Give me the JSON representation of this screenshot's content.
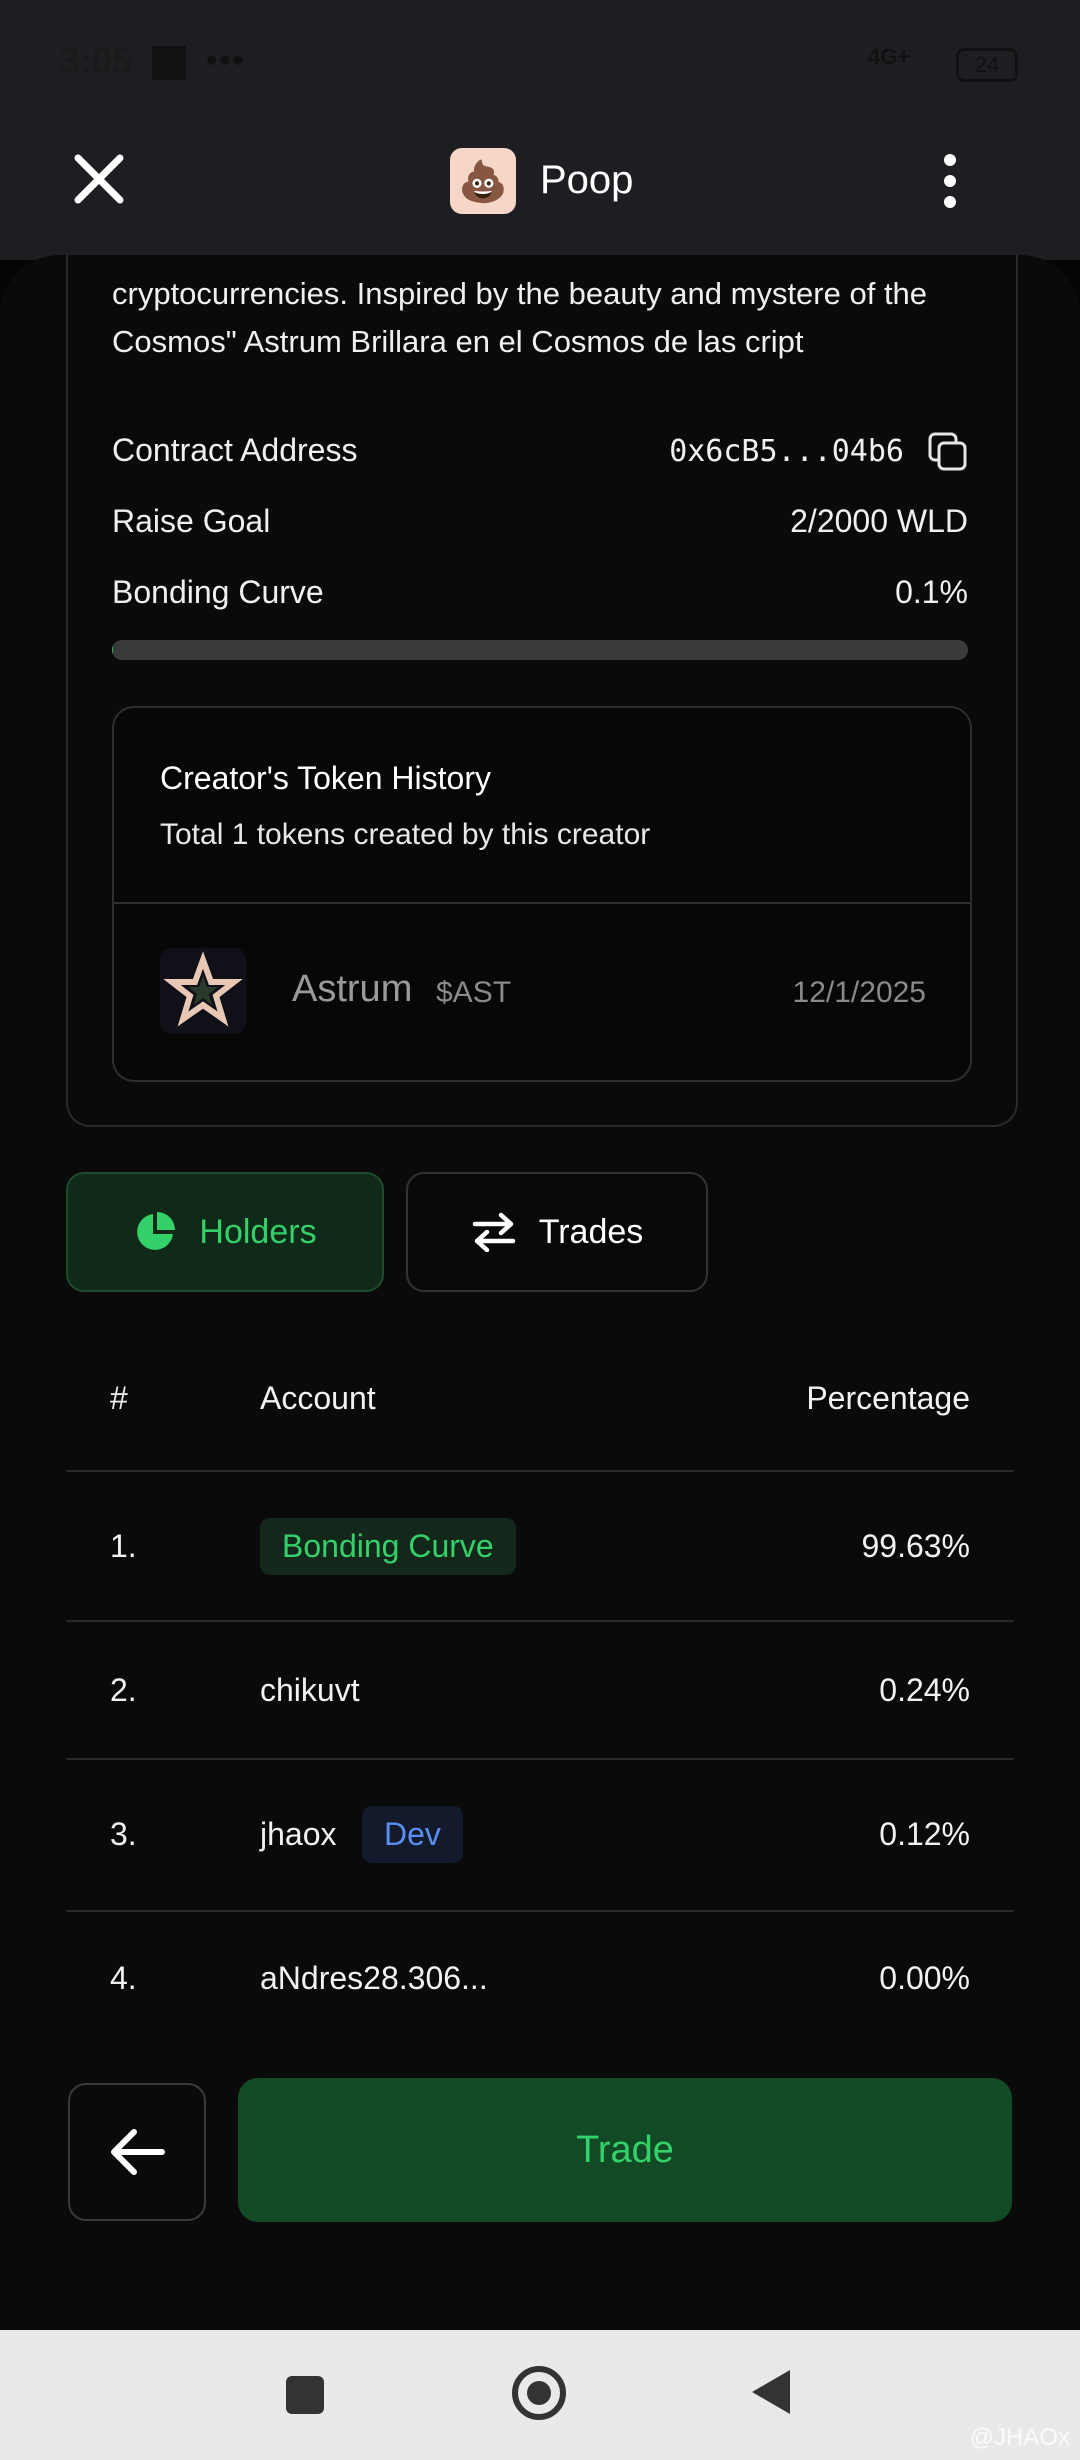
{
  "status_bar": {
    "time": "3:05",
    "dots": "•••",
    "network": "4G+",
    "battery": "24"
  },
  "header": {
    "app_name": "Poop",
    "app_emoji": "💩"
  },
  "token_info": {
    "description": "cryptocurrencies. Inspired by the beauty and mystere of the Cosmos\" Astrum Brillara en el Cosmos de las cript",
    "contract_label": "Contract Address",
    "contract_value": "0x6cB5...04b6",
    "raise_label": "Raise Goal",
    "raise_value": "2/2000 WLD",
    "curve_label": "Bonding Curve",
    "curve_value": "0.1%",
    "curve_progress": 0.001
  },
  "creator_history": {
    "title": "Creator's Token History",
    "subtitle": "Total 1 tokens created by this creator",
    "tokens": [
      {
        "name": "Astrum",
        "symbol": "$AST",
        "date": "12/1/2025"
      }
    ]
  },
  "tabs": [
    {
      "label": "Holders",
      "active": true
    },
    {
      "label": "Trades",
      "active": false
    }
  ],
  "holders_table": {
    "headers": {
      "rank": "#",
      "account": "Account",
      "percentage": "Percentage"
    },
    "rows": [
      {
        "rank": "1.",
        "account": "Bonding Curve",
        "badge": "",
        "percentage": "99.63%"
      },
      {
        "rank": "2.",
        "account": "chikuvt",
        "badge": "",
        "percentage": "0.24%"
      },
      {
        "rank": "3.",
        "account": "jhaox",
        "badge": "Dev",
        "percentage": "0.12%"
      },
      {
        "rank": "4.",
        "account": "aNdres28.306...",
        "badge": "",
        "percentage": "0.00%"
      }
    ]
  },
  "footer": {
    "trade_label": "Trade"
  },
  "watermark": "@JHAOx",
  "colors": {
    "accent_green": "#34d06a",
    "dev_blue": "#5b8ef0",
    "background": "#0a0a0a"
  }
}
